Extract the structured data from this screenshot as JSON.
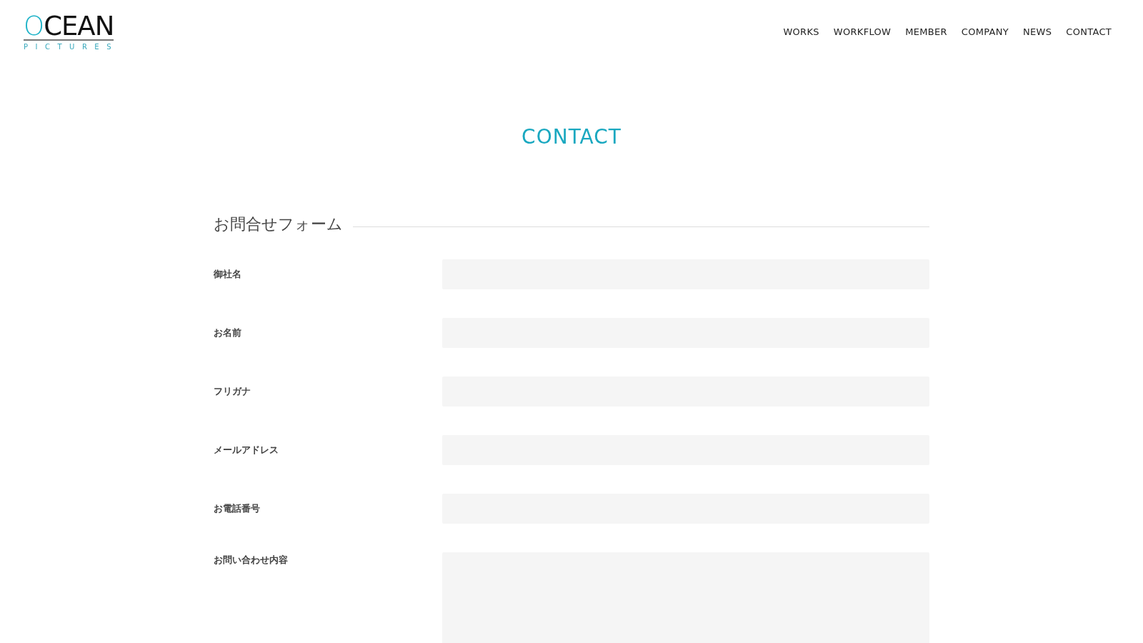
{
  "logo": {
    "accent": "O",
    "rest": "CEAN",
    "tagline": "PICTURES"
  },
  "nav": [
    {
      "label": "WORKS"
    },
    {
      "label": "WORKFLOW"
    },
    {
      "label": "MEMBER"
    },
    {
      "label": "COMPANY"
    },
    {
      "label": "NEWS"
    },
    {
      "label": "CONTACT"
    }
  ],
  "page_title": "CONTACT",
  "form": {
    "heading": "お問合せフォーム",
    "fields": [
      {
        "label": "御社名",
        "kind": "text"
      },
      {
        "label": "お名前",
        "kind": "text"
      },
      {
        "label": "フリガナ",
        "kind": "text"
      },
      {
        "label": "メールアドレス",
        "kind": "text"
      },
      {
        "label": "お電話番号",
        "kind": "text"
      },
      {
        "label": "お問い合わせ内容",
        "kind": "textarea"
      }
    ]
  }
}
